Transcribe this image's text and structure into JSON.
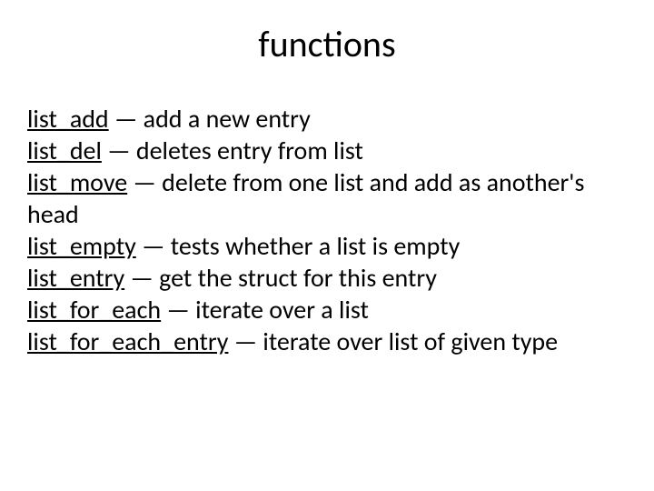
{
  "title": "functions",
  "items": [
    {
      "name": "list_add",
      "desc": " — add a new entry"
    },
    {
      "name": "list_del",
      "desc": " — deletes entry from list"
    },
    {
      "name": "list_move",
      "desc": " — delete from one list and add as another's head"
    },
    {
      "name": "list_empty",
      "desc": " — tests whether a list is empty"
    },
    {
      "name": "list_entry",
      "desc": " — get the struct for this entry"
    },
    {
      "name": "list_for_each",
      "desc": " — iterate over a list"
    },
    {
      "name": "list_for_each_entry",
      "desc": " — iterate over list of given type"
    }
  ]
}
